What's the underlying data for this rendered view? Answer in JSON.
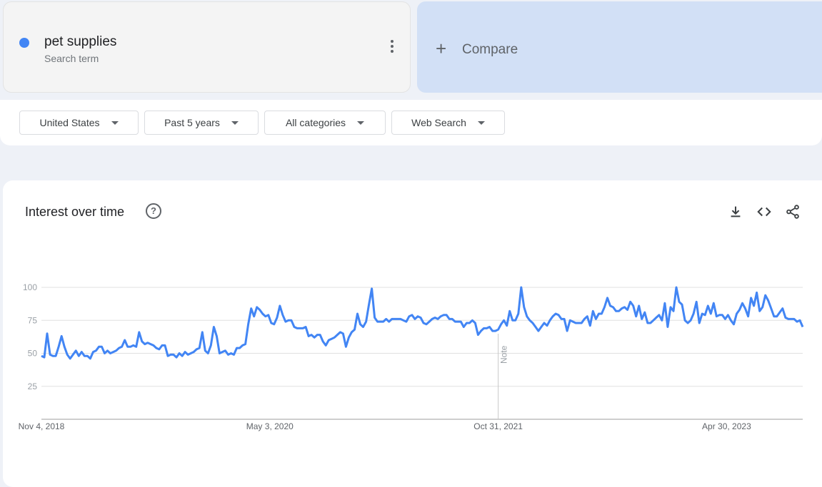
{
  "search_term": {
    "label": "pet supplies",
    "sublabel": "Search term",
    "color": "#4285f4"
  },
  "compare": {
    "label": "Compare"
  },
  "filters": [
    {
      "label": "United States"
    },
    {
      "label": "Past 5 years"
    },
    {
      "label": "All categories"
    },
    {
      "label": "Web Search"
    }
  ],
  "chart_panel": {
    "title": "Interest over time"
  },
  "icons": {
    "download": "download-icon",
    "embed": "embed-code-icon",
    "share": "share-icon",
    "help": "help-icon"
  },
  "chart_data": {
    "type": "line",
    "title": "Interest over time",
    "ylim": [
      0,
      100
    ],
    "yticks": [
      25,
      50,
      75,
      100
    ],
    "xlim": [
      "2018-11-04",
      "2023-10-29"
    ],
    "xticks": [
      {
        "date": "2018-11-04",
        "label": "Nov 4, 2018"
      },
      {
        "date": "2020-05-03",
        "label": "May 3, 2020"
      },
      {
        "date": "2021-10-31",
        "label": "Oct 31, 2021"
      },
      {
        "date": "2023-04-30",
        "label": "Apr 30, 2023"
      }
    ],
    "annotation": {
      "date": "2021-10-31",
      "label": "Note"
    },
    "grid": true,
    "series": [
      {
        "name": "pet supplies",
        "color": "#4285f4",
        "values": [
          48,
          47,
          65,
          49,
          48,
          48,
          55,
          63,
          55,
          49,
          46,
          49,
          52,
          48,
          51,
          48,
          48,
          46,
          51,
          52,
          55,
          55,
          50,
          52,
          50,
          51,
          52,
          54,
          55,
          60,
          55,
          55,
          56,
          55,
          66,
          59,
          57,
          58,
          57,
          56,
          54,
          53,
          56,
          56,
          48,
          49,
          49,
          47,
          50,
          48,
          51,
          49,
          50,
          51,
          53,
          54,
          66,
          52,
          50,
          56,
          70,
          63,
          50,
          51,
          52,
          49,
          50,
          49,
          54,
          54,
          56,
          57,
          72,
          84,
          78,
          85,
          83,
          80,
          78,
          79,
          73,
          72,
          77,
          86,
          79,
          74,
          75,
          75,
          70,
          69,
          69,
          69,
          70,
          63,
          64,
          62,
          64,
          64,
          59,
          56,
          60,
          61,
          62,
          64,
          66,
          65,
          55,
          62,
          66,
          68,
          80,
          72,
          70,
          74,
          87,
          99,
          77,
          74,
          74,
          74,
          76,
          74,
          76,
          76,
          76,
          76,
          75,
          74,
          78,
          79,
          76,
          78,
          77,
          73,
          72,
          74,
          76,
          77,
          76,
          78,
          79,
          79,
          76,
          76,
          74,
          74,
          74,
          70,
          73,
          73,
          75,
          73,
          64,
          67,
          69,
          69,
          70,
          67,
          67,
          68,
          72,
          75,
          71,
          82,
          75,
          75,
          80,
          100,
          85,
          78,
          75,
          73,
          70,
          67,
          70,
          73,
          71,
          75,
          78,
          80,
          79,
          76,
          76,
          67,
          75,
          74,
          73,
          73,
          73,
          76,
          78,
          71,
          82,
          76,
          80,
          80,
          85,
          92,
          86,
          85,
          82,
          82,
          84,
          85,
          83,
          89,
          86,
          78,
          86,
          76,
          81,
          73,
          73,
          75,
          77,
          79,
          75,
          88,
          70,
          85,
          82,
          100,
          89,
          87,
          75,
          73,
          75,
          80,
          89,
          73,
          80,
          79,
          86,
          80,
          88,
          78,
          79,
          79,
          76,
          79,
          75,
          72,
          80,
          83,
          88,
          84,
          78,
          92,
          86,
          96,
          82,
          85,
          94,
          90,
          84,
          78,
          78,
          81,
          84,
          77,
          76,
          76,
          76,
          74,
          75,
          70
        ]
      }
    ]
  }
}
